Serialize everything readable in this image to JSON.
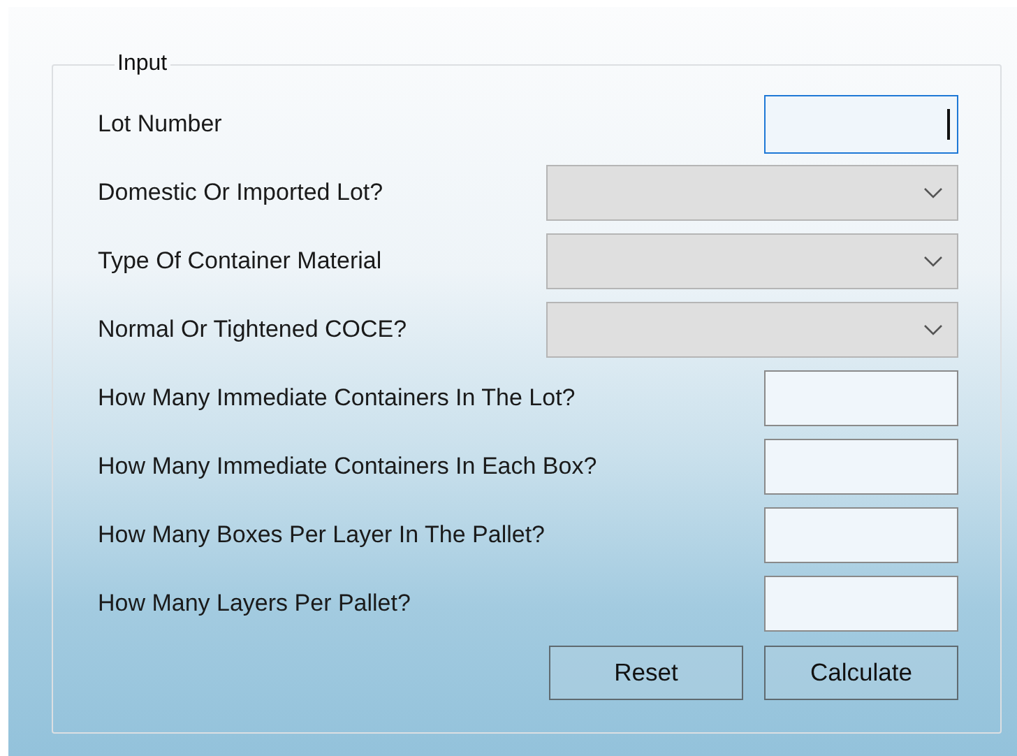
{
  "group": {
    "title": "Input"
  },
  "fields": [
    {
      "kind": "text",
      "label": "Lot Number",
      "focused": true
    },
    {
      "kind": "combo",
      "label": "Domestic Or Imported Lot?"
    },
    {
      "kind": "combo",
      "label": "Type Of Container Material"
    },
    {
      "kind": "combo",
      "label": "Normal Or Tightened COCE?"
    },
    {
      "kind": "text",
      "label": "How Many Immediate Containers In The Lot?",
      "focused": false
    },
    {
      "kind": "text",
      "label": "How Many Immediate Containers In Each Box?",
      "focused": false
    },
    {
      "kind": "text",
      "label": "How Many Boxes Per Layer In The Pallet?",
      "focused": false
    },
    {
      "kind": "text",
      "label": "How Many Layers Per Pallet?",
      "focused": false
    }
  ],
  "buttons": [
    "Reset",
    "Calculate"
  ]
}
